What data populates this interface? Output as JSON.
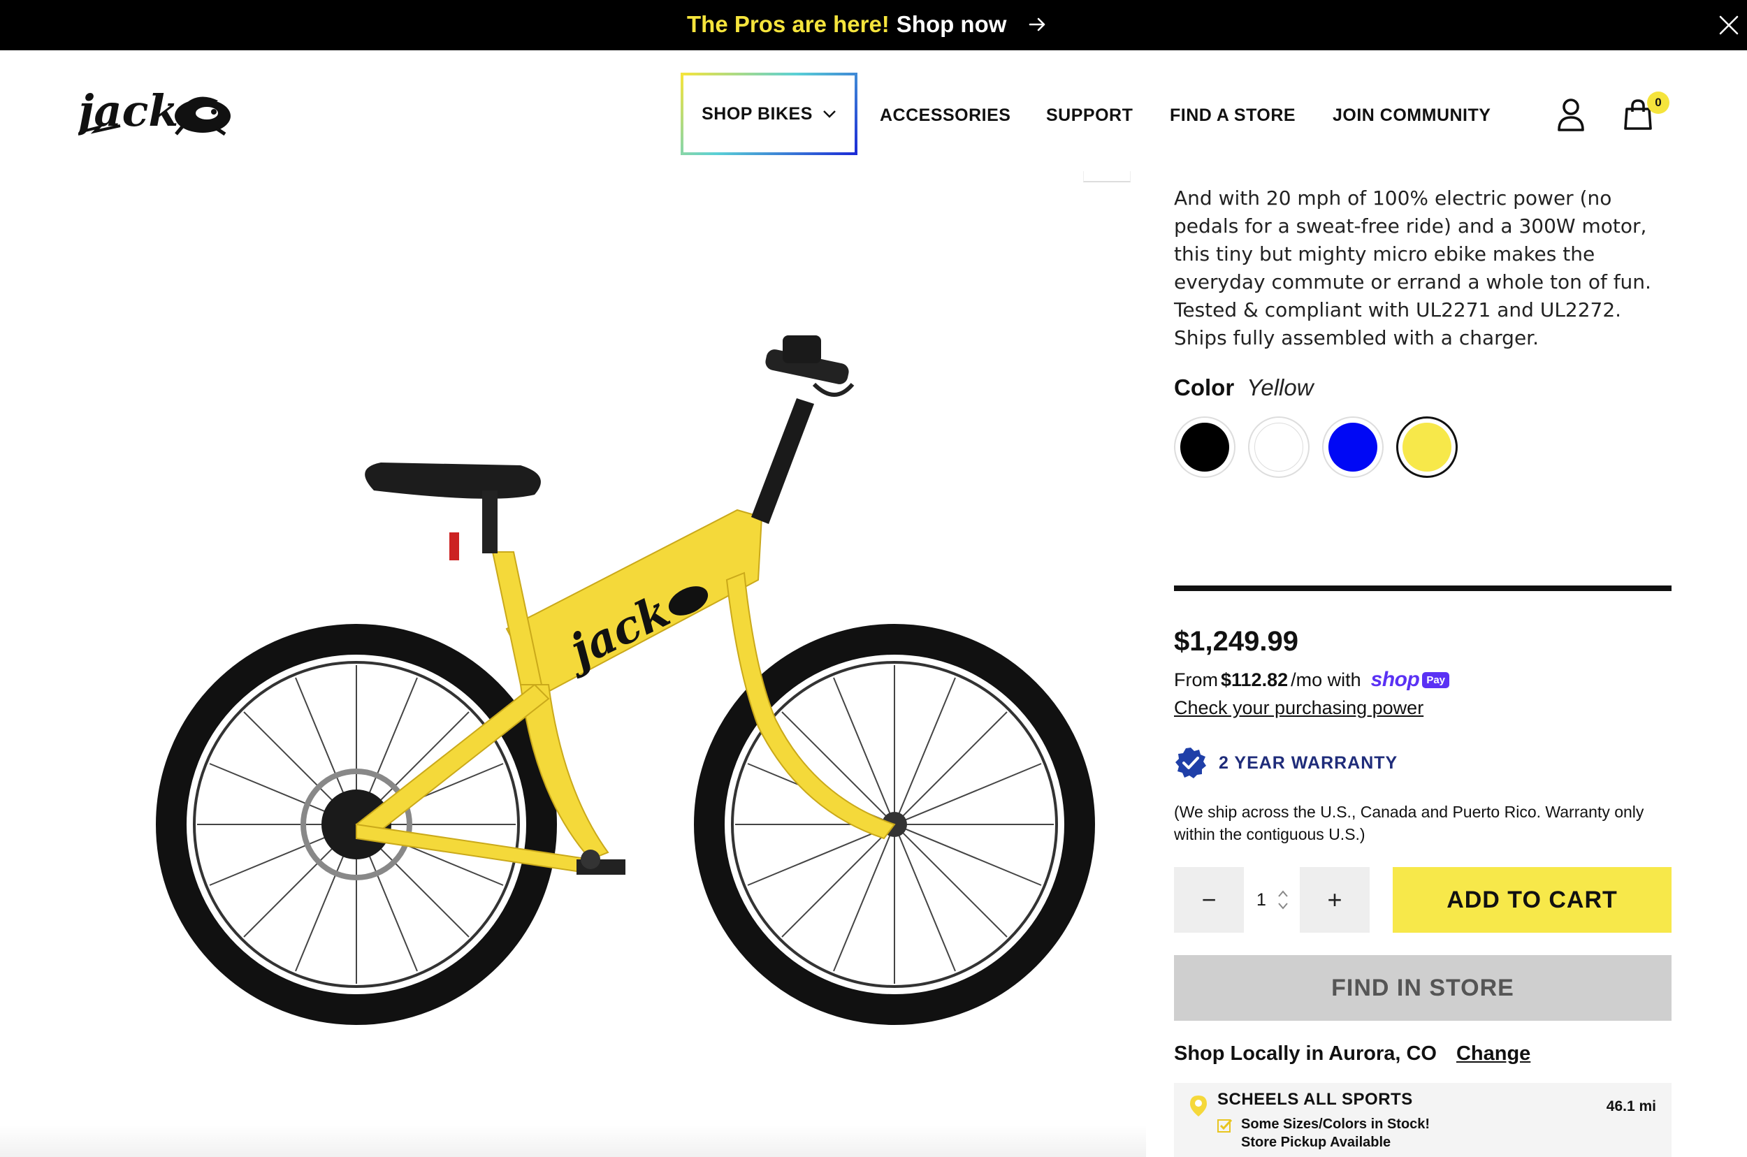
{
  "announcement": {
    "highlight": "The Pros are here!",
    "cta": "Shop now",
    "arrow_icon": "arrow-right-icon",
    "close_icon": "close-icon"
  },
  "header": {
    "logo_text": "jack",
    "nav": {
      "shop_bikes": "SHOP BIKES",
      "accessories": "ACCESSORIES",
      "support": "SUPPORT",
      "find_store": "FIND A STORE",
      "join_community": "JOIN COMMUNITY"
    },
    "account_icon": "user-icon",
    "cart_icon": "shopping-bag-icon",
    "cart_count": "0"
  },
  "product": {
    "description": "And with 20 mph of 100% electric power (no pedals for a sweat-free ride) and a 300W motor, this tiny but mighty micro ebike makes the everyday commute or errand a whole ton of fun. Tested & compliant with UL2271 and UL2272. Ships fully assembled with a charger.",
    "color_label": "Color",
    "color_value": "Yellow",
    "swatches": [
      {
        "name": "Black",
        "hex": "#000000"
      },
      {
        "name": "White",
        "hex": "#ffffff"
      },
      {
        "name": "Blue",
        "hex": "#0008f5"
      },
      {
        "name": "Yellow",
        "hex": "#f7e84a"
      }
    ],
    "selected_swatch": "Yellow",
    "price": "$1,249.99",
    "installment": {
      "prefix": "From",
      "amount": "$112.82",
      "suffix": "/mo with",
      "provider_word": "shop",
      "provider_badge": "Pay"
    },
    "check_power": "Check your purchasing power",
    "warranty": "2 YEAR WARRANTY",
    "warranty_icon": "check-badge-icon",
    "ship_note": "(We ship across the U.S., Canada and Puerto Rico. Warranty only within the contiguous U.S.)",
    "quantity": "1",
    "qty_minus": "−",
    "qty_plus": "+",
    "add_to_cart": "ADD TO CART",
    "find_in_store": "FIND IN STORE",
    "local_prefix": "Shop Locally in Aurora, CO",
    "local_change": "Change",
    "store": {
      "name": "SCHEELS ALL SPORTS",
      "distance": "46.1 mi",
      "availability_line1": "Some Sizes/Colors in Stock!",
      "availability_line2": "Store Pickup Available"
    }
  },
  "colors": {
    "accent_yellow": "#f7e84a",
    "announcement_yellow": "#f5e43c",
    "warranty_blue": "#1f2c7a",
    "shoppay_purple": "#5a31f4",
    "find_store_gray": "#cfcfcf"
  }
}
